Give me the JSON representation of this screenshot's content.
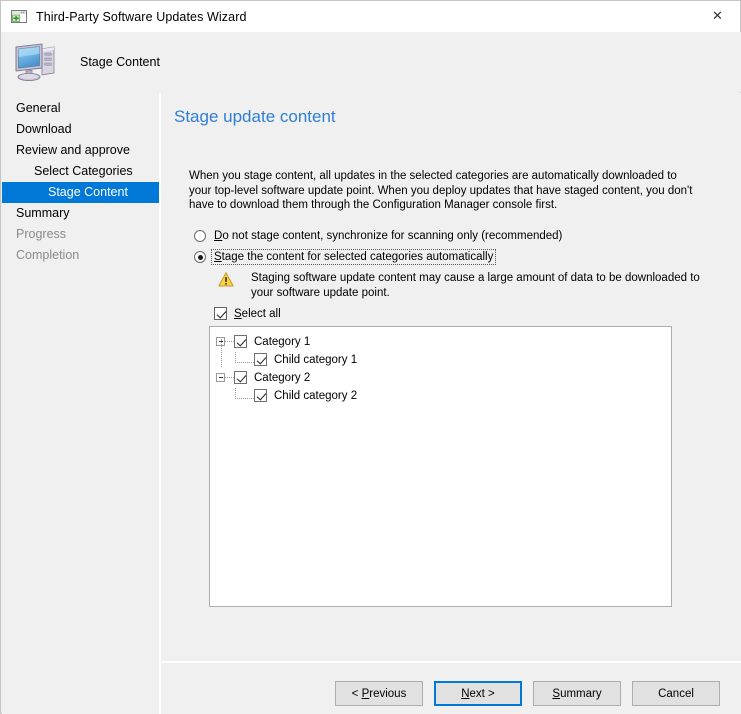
{
  "window": {
    "title": "Third-Party Software Updates Wizard",
    "title_icon": "wizard-window-icon",
    "close_label": "✕",
    "banner_title": "Stage Content",
    "banner_icon": "computer-icon"
  },
  "sidebar": {
    "items": [
      {
        "label": "General",
        "indent": 0,
        "state": "normal"
      },
      {
        "label": "Download",
        "indent": 0,
        "state": "normal"
      },
      {
        "label": "Review and approve",
        "indent": 0,
        "state": "normal"
      },
      {
        "label": "Select Categories",
        "indent": 1,
        "state": "normal"
      },
      {
        "label": "Stage Content",
        "indent": 2,
        "state": "selected"
      },
      {
        "label": "Summary",
        "indent": 0,
        "state": "normal"
      },
      {
        "label": "Progress",
        "indent": 0,
        "state": "disabled"
      },
      {
        "label": "Completion",
        "indent": 0,
        "state": "disabled"
      }
    ]
  },
  "content": {
    "heading": "Stage update content",
    "intro": "When you stage content, all updates in the selected categories are automatically downloaded to your top-level software update point. When you deploy updates that have staged content, you don't have to download them through the Configuration Manager console first.",
    "options": [
      {
        "accel": "D",
        "rest": "o not stage content, synchronize for scanning only (recommended)",
        "selected": false,
        "focused": false
      },
      {
        "accel": "S",
        "rest": "tage the content for selected categories automatically",
        "selected": true,
        "focused": true
      }
    ],
    "warning": {
      "icon": "warning-triangle-icon",
      "text": "Staging software update content may cause a large amount of data to be downloaded to your software update point."
    },
    "select_all": {
      "accel": "S",
      "rest": "elect all",
      "checked": true
    },
    "tree": [
      {
        "label": "Category 1",
        "level": 0,
        "checked": true,
        "expanded": true
      },
      {
        "label": "Child category 1",
        "level": 1,
        "checked": true,
        "expanded": false
      },
      {
        "label": "Category 2",
        "level": 0,
        "checked": true,
        "expanded": true
      },
      {
        "label": "Child category 2",
        "level": 1,
        "checked": true,
        "expanded": false
      }
    ]
  },
  "buttons": [
    {
      "name": "previous-button",
      "pre": "< ",
      "accel": "P",
      "rest": "revious",
      "default": false
    },
    {
      "name": "next-button",
      "pre": "",
      "accel": "N",
      "rest": "ext >",
      "default": true
    },
    {
      "name": "summary-button",
      "pre": "",
      "accel": "S",
      "rest": "ummary",
      "default": false
    },
    {
      "name": "cancel-button",
      "pre": "Cancel",
      "accel": "",
      "rest": "",
      "default": false
    }
  ],
  "colors": {
    "accent": "#0078d7",
    "heading": "#2f7fd1",
    "dialog_bg": "#f0f0f0",
    "warning": "#f5c518"
  }
}
